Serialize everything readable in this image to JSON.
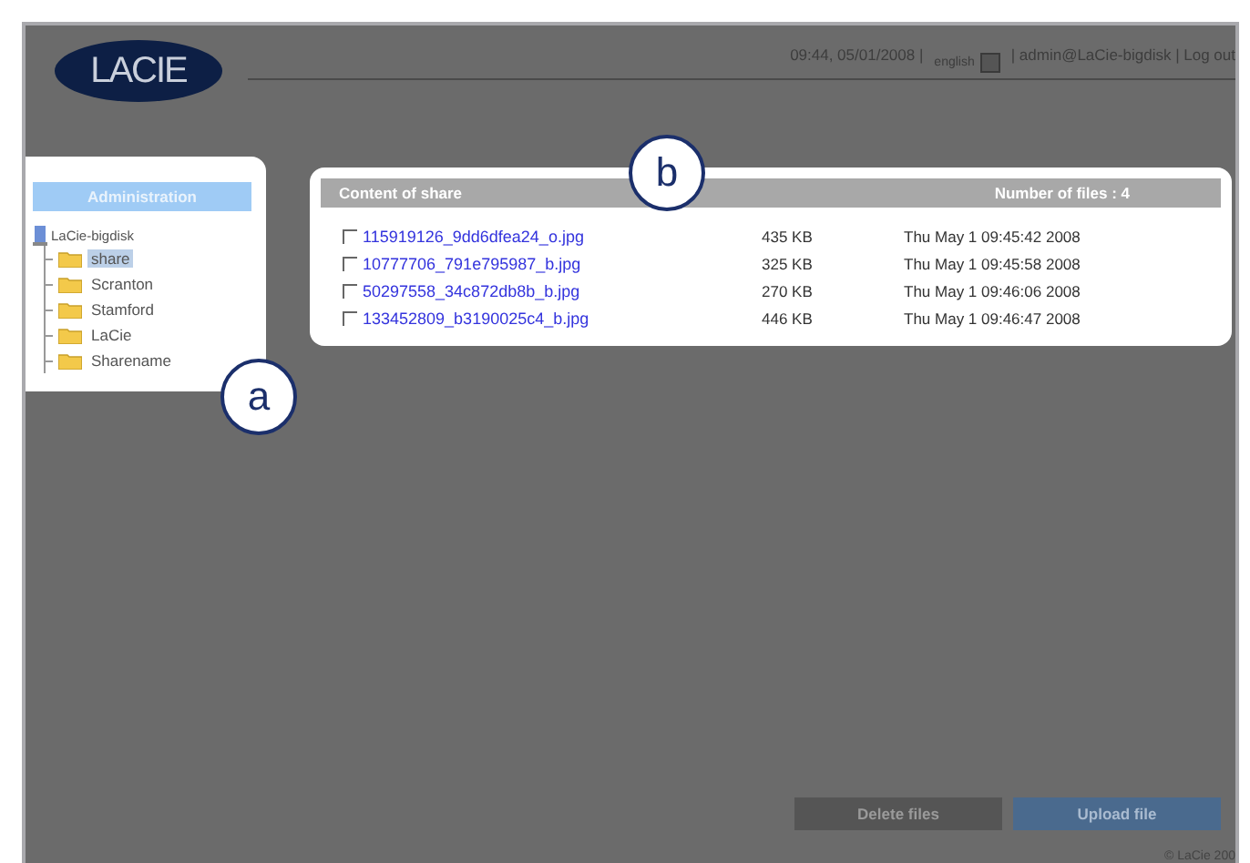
{
  "header": {
    "logo": "LACIE",
    "datetime": "09:44, 05/01/2008 |",
    "language": "english",
    "user": "| admin@LaCie-bigdisk | Log out"
  },
  "sidebar": {
    "title": "Administration",
    "tree": {
      "label": "LaCie-bigdisk",
      "children": [
        {
          "label": "share",
          "selected": true
        },
        {
          "label": "Scranton",
          "selected": false
        },
        {
          "label": "Stamford",
          "selected": false
        },
        {
          "label": "LaCie",
          "selected": false
        },
        {
          "label": "Sharename",
          "selected": false
        }
      ]
    }
  },
  "content": {
    "title": "Content of share",
    "count": "Number of files : 4",
    "files": [
      {
        "name": "115919126_9dd6dfea24_o.jpg",
        "size": "435 KB",
        "date": "Thu May 1 09:45:42 2008",
        "checked": false
      },
      {
        "name": "10777706_791e795987_b.jpg",
        "size": "325 KB",
        "date": "Thu May 1 09:45:58 2008",
        "checked": false
      },
      {
        "name": "50297558_34c872db8b_b.jpg",
        "size": "270 KB",
        "date": "Thu May 1 09:46:06 2008",
        "checked": false
      },
      {
        "name": "133452809_b3190025c4_b.jpg",
        "size": "446 KB",
        "date": "Thu May 1 09:46:47 2008",
        "checked": false
      }
    ]
  },
  "buttons": [
    {
      "label": "Delete files",
      "kind": "secondary"
    },
    {
      "label": "Upload file",
      "kind": "primary"
    }
  ],
  "footer": "© LaCie 200",
  "callouts": [
    {
      "label": "a"
    },
    {
      "label": "b"
    }
  ]
}
